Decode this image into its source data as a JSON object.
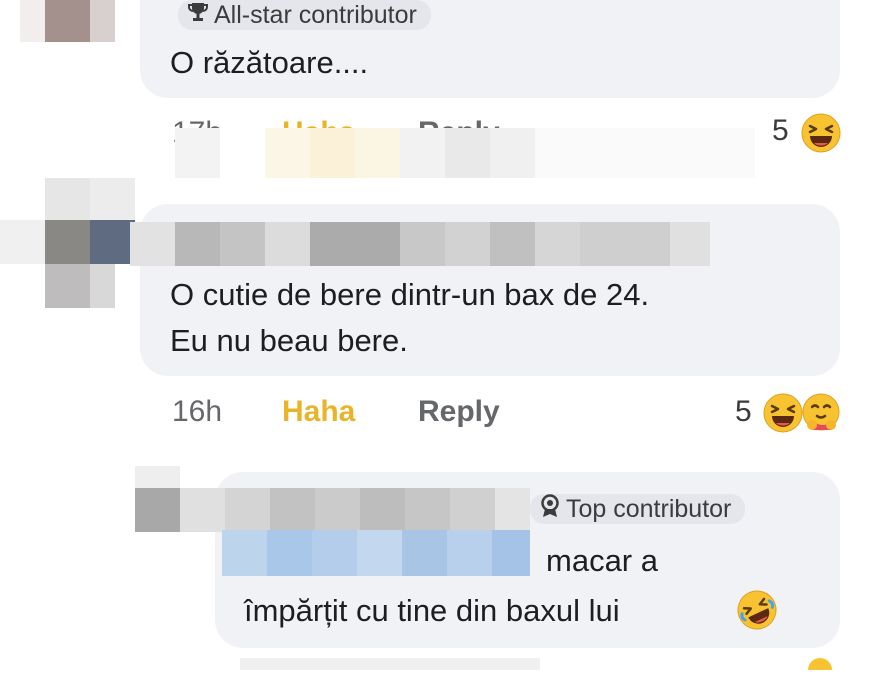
{
  "comment1": {
    "badge": "All-star contributor",
    "text": "O răzătoare....",
    "time": "17h",
    "reaction_label": "Haha",
    "reply_label": "Reply",
    "reaction_count": "5",
    "emoji_icons": [
      "laughing-face-icon"
    ]
  },
  "comment2": {
    "text_line1": "O cutie de bere dintr-un bax de 24.",
    "text_line2": "Eu nu beau bere.",
    "time": "16h",
    "reaction_label": "Haha",
    "reply_label": "Reply",
    "reaction_count": "5",
    "emoji_icons": [
      "laughing-face-icon",
      "hug-face-icon"
    ]
  },
  "comment3": {
    "badge": "Top contributor",
    "text_line1": "macar a",
    "text_line2": "împărțit cu tine din baxul lui",
    "emoji_icons": [
      "rolling-laughing-face-icon"
    ]
  },
  "colors": {
    "bubble": "#f0f2f5",
    "haha": "#e8b52a",
    "meta": "#65676b"
  }
}
